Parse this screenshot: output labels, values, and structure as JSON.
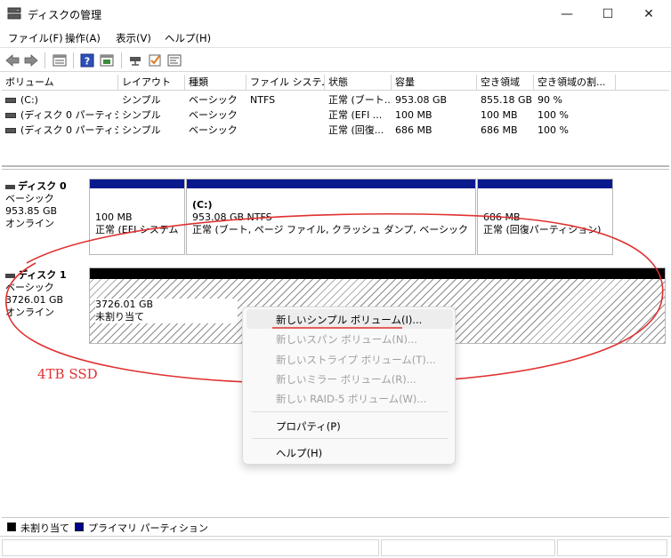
{
  "window": {
    "title": "ディスクの管理",
    "minimize_glyph": "—",
    "maximize_glyph": "☐",
    "close_glyph": "✕"
  },
  "menu": [
    "ファイル(F)",
    "操作(A)",
    "表示(V)",
    "ヘルプ(H)"
  ],
  "toolbar": {
    "icons": [
      "back-arrow-icon",
      "forward-arrow-icon",
      "volume-list-icon",
      "help-icon",
      "properties-icon",
      "connect-icon",
      "check-icon",
      "console-icon"
    ]
  },
  "volume_list": {
    "columns": [
      "ボリューム",
      "レイアウト",
      "種類",
      "ファイル システム",
      "状態",
      "容量",
      "空き領域",
      "空き領域の割..."
    ],
    "rows": [
      [
        "(C:)",
        "シンプル",
        "ベーシック",
        "NTFS",
        "正常 (ブート...",
        "953.08 GB",
        "855.18 GB",
        "90 %"
      ],
      [
        "(ディスク 0 パーティシ...",
        "シンプル",
        "ベーシック",
        "",
        "正常 (EFI ...",
        "100 MB",
        "100 MB",
        "100 %"
      ],
      [
        "(ディスク 0 パーティシ...",
        "シンプル",
        "ベーシック",
        "",
        "正常 (回復...",
        "686 MB",
        "686 MB",
        "100 %"
      ]
    ]
  },
  "disks": [
    {
      "name": "ディスク 0",
      "type": "ベーシック",
      "size": "953.85 GB",
      "status": "オンライン",
      "partitions": [
        {
          "line1": "100 MB",
          "line2": "正常 (EFI システム"
        },
        {
          "header": "(C:)",
          "line1": "953.08 GB NTFS",
          "line2": "正常 (ブート, ページ ファイル, クラッシュ ダンプ, ベーシック データ パ"
        },
        {
          "line1": "686 MB",
          "line2": "正常 (回復パーティション)"
        }
      ]
    },
    {
      "name": "ディスク 1",
      "type": "ベーシック",
      "size": "3726.01 GB",
      "status": "オンライン",
      "partitions": [
        {
          "line1": "3726.01 GB",
          "line2": "未割り当て"
        }
      ]
    }
  ],
  "annotation": {
    "label": "4TB SSD",
    "color": "#e03030"
  },
  "context_menu": {
    "items": [
      {
        "label": "新しいシンプル ボリューム(I)...",
        "enabled": true
      },
      {
        "label": "新しいスパン ボリューム(N)...",
        "enabled": false
      },
      {
        "label": "新しいストライプ ボリューム(T)...",
        "enabled": false
      },
      {
        "label": "新しいミラー ボリューム(R)...",
        "enabled": false
      },
      {
        "label": "新しい RAID-5 ボリューム(W)...",
        "enabled": false
      },
      {
        "label": "プロパティ(P)",
        "enabled": true
      },
      {
        "label": "ヘルプ(H)",
        "enabled": true
      }
    ]
  },
  "legend": [
    {
      "label": "未割り当て",
      "color": "#000000"
    },
    {
      "label": "プライマリ パーティション",
      "color": "#00008b"
    }
  ],
  "colors": {
    "primary_partition_bar": "#0a1a8c",
    "unallocated_bar": "#000000"
  }
}
